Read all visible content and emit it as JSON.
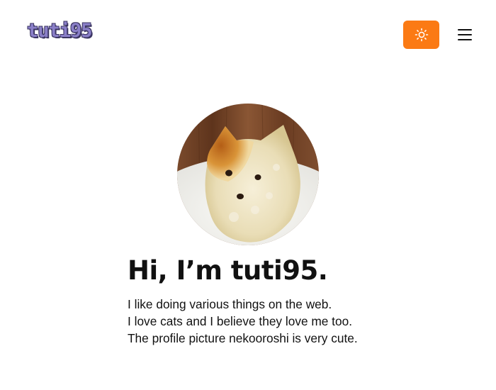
{
  "header": {
    "logo_text": "tuti95",
    "theme_toggle": {
      "icon": "sun-icon",
      "color": "#fb7a14"
    },
    "menu": {
      "icon": "hamburger-menu-icon"
    }
  },
  "profile": {
    "avatar": {
      "description_icon": "profile-avatar"
    }
  },
  "intro": {
    "headline": "Hi, I’m tuti95.",
    "bio_lines": [
      "I like doing various things on the web.",
      "I love cats and I believe they love me too.",
      "The profile picture nekooroshi is very cute."
    ]
  },
  "colors": {
    "accent": "#fb7a14",
    "logo_fill": "#8a7fc8",
    "logo_outline": "#3b3562",
    "text": "#111111",
    "background": "#ffffff"
  }
}
